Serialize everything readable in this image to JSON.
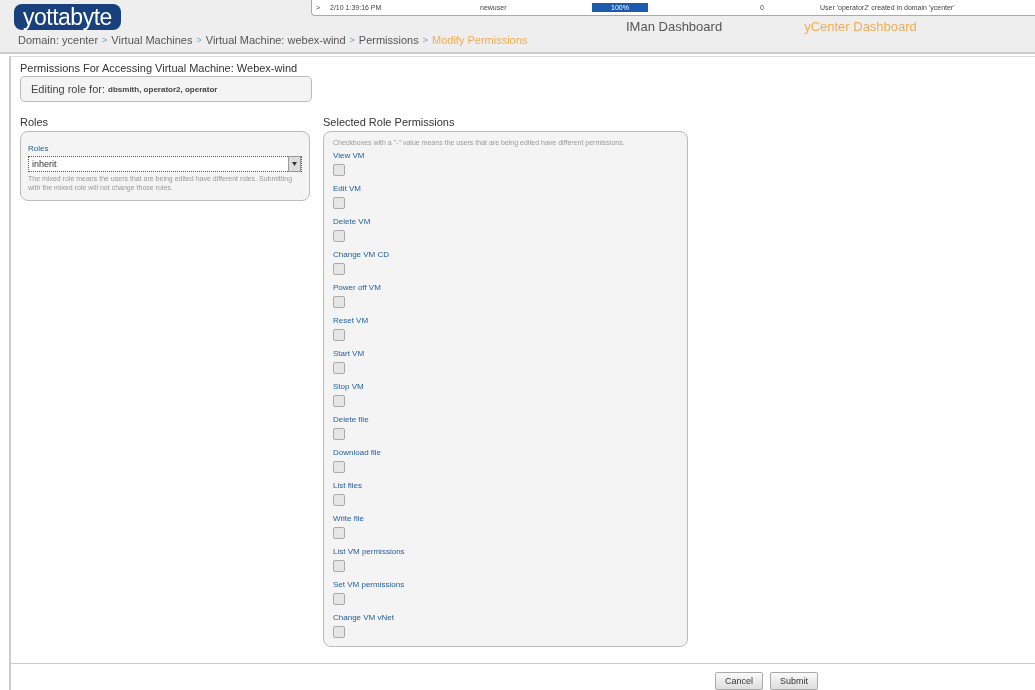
{
  "logo": "yottabyte",
  "activity": {
    "toggle": ">",
    "time": "2/10 1:39:16 PM",
    "user": "newuser",
    "progress": {
      "level": 1,
      "reading": "100%"
    },
    "count": "0",
    "message": "User 'operator2' created in domain 'ycenter'"
  },
  "nav": [
    {
      "label": "IMan Dashboard",
      "selected": false
    },
    {
      "label": "yCenter Dashboard",
      "selected": true
    }
  ],
  "breadcrumb": [
    {
      "label": "Domain: ycenter",
      "current": false
    },
    {
      "label": "Virtual Machines",
      "current": false
    },
    {
      "label": "Virtual Machine: webex-wind",
      "current": false
    },
    {
      "label": "Permissions",
      "current": false
    },
    {
      "label": "Modify Permissions",
      "current": true
    }
  ],
  "breadcrumb_separator": ">",
  "page_title": "Permissions For Accessing Virtual Machine: Webex-wind",
  "editing": {
    "label": "Editing role for:",
    "users": "dbsmith, operator2, operator"
  },
  "roles": {
    "heading": "Roles",
    "field_label": "Roles",
    "value": "inherit",
    "help": "The mixed role means the users that are being edited have different roles. Submitting with the mixed role will not change those roles."
  },
  "permissions": {
    "heading": "Selected Role Permissions",
    "note": "Checkboxes with a \"-\" value means the users that are being edited have different permissions.",
    "items": [
      {
        "label": "View VM",
        "checked": false
      },
      {
        "label": "Edit VM",
        "checked": false
      },
      {
        "label": "Delete VM",
        "checked": false
      },
      {
        "label": "Change VM CD",
        "checked": false
      },
      {
        "label": "Power off VM",
        "checked": false
      },
      {
        "label": "Reset VM",
        "checked": false
      },
      {
        "label": "Start VM",
        "checked": false
      },
      {
        "label": "Stop VM",
        "checked": false
      },
      {
        "label": "Delete file",
        "checked": false
      },
      {
        "label": "Download file",
        "checked": false
      },
      {
        "label": "List files",
        "checked": false
      },
      {
        "label": "Write file",
        "checked": false
      },
      {
        "label": "List VM permissions",
        "checked": false
      },
      {
        "label": "Set VM permissions",
        "checked": false
      },
      {
        "label": "Change VM vNet",
        "checked": false
      }
    ]
  },
  "buttons": [
    "Cancel",
    "Submit"
  ]
}
